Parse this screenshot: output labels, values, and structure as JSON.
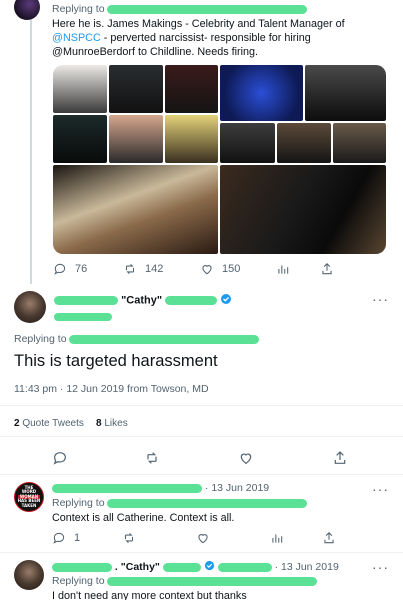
{
  "first_tweet": {
    "replying_prefix": "Replying to",
    "text_prefix": "Here he is.  James Makings - Celebrity and Talent Manager of ",
    "mention_nspcc": "@NSPCC",
    "text_suffix": " - perverted narcissist- responsible for hiring @MunroeBerdorf to Childline. Needs firing.",
    "counts": {
      "replies": "76",
      "retweets": "142",
      "likes": "150"
    }
  },
  "main_tweet": {
    "name_visible": "\"Cathy\"",
    "replying_prefix": "Replying to",
    "text": "This is targeted harassment",
    "timestamp": "11:43 pm · 12 Jun 2019 from Towson, MD",
    "stats": {
      "quote_count": "2",
      "quote_label": "Quote Tweets",
      "likes_count": "8",
      "likes_label": "Likes"
    }
  },
  "reply1": {
    "date": "· 13 Jun 2019",
    "replying_prefix": "Replying to",
    "text": "Context is all Catherine. Context is all.",
    "reply_count": "1",
    "avatar_lines": [
      "THE",
      "WORD",
      "WOMAN",
      "HAS BEEN",
      "TAKEN"
    ]
  },
  "reply2": {
    "name_visible": ". \"Cathy\"",
    "date": "· 13 Jun 2019",
    "replying_prefix": "Replying to",
    "text": "I don't need any more context but thanks"
  },
  "colors": {
    "accent": "#1d9bf0",
    "redaction": "#3ddc84",
    "verified": "#1d9bf0"
  }
}
